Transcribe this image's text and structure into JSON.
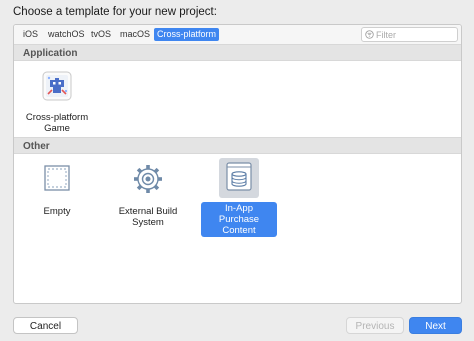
{
  "dialog": {
    "title": "Choose a template for your new project:"
  },
  "tabs": [
    {
      "label": "iOS",
      "selected": false
    },
    {
      "label": "watchOS",
      "selected": false
    },
    {
      "label": "tvOS",
      "selected": false
    },
    {
      "label": "macOS",
      "selected": false
    },
    {
      "label": "Cross-platform",
      "selected": true
    }
  ],
  "filter": {
    "placeholder": "Filter",
    "value": ""
  },
  "sections": [
    {
      "header": "Application",
      "templates": [
        {
          "label": "Cross-platform Game",
          "icon": "game-controller-icon",
          "selected": false
        }
      ]
    },
    {
      "header": "Other",
      "templates": [
        {
          "label": "Empty",
          "icon": "empty-document-icon",
          "selected": false
        },
        {
          "label": "External Build System",
          "icon": "gear-icon",
          "selected": false
        },
        {
          "label": "In-App Purchase Content",
          "icon": "database-icon",
          "selected": true
        }
      ]
    }
  ],
  "buttons": {
    "cancel": "Cancel",
    "previous": "Previous",
    "next": "Next"
  },
  "colors": {
    "accent": "#3f86f0"
  }
}
